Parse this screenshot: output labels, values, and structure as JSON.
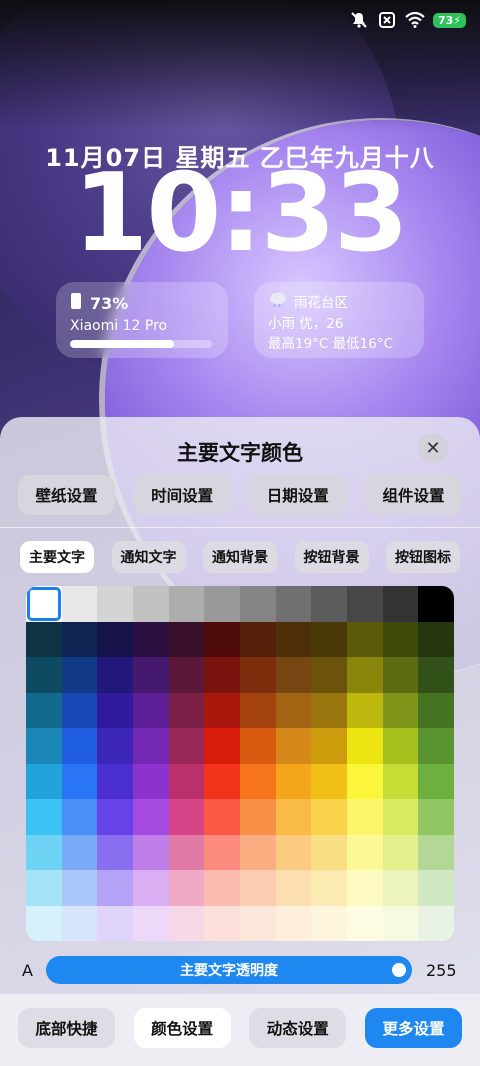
{
  "status_bar": {
    "battery": "73"
  },
  "lockscreen": {
    "date": "11月07日 星期五 乙巳年九月十八",
    "time": "10:33"
  },
  "battery_widget": {
    "percent": "73%",
    "device": "Xiaomi 12 Pro",
    "level": 0.73
  },
  "weather_widget": {
    "location": "雨花台区",
    "condition": "小雨 优，26",
    "range": "最高19°C  最低16°C"
  },
  "panel": {
    "title": "主要文字颜色",
    "top_tabs": [
      "壁纸设置",
      "时间设置",
      "日期设置",
      "组件设置"
    ],
    "sub_tabs": [
      "主要文字",
      "通知文字",
      "通知背景",
      "按钮背景",
      "按钮图标"
    ],
    "slider": {
      "prefix": "A",
      "label": "主要文字透明度",
      "value": "255"
    },
    "bottom_buttons": [
      "底部快捷",
      "颜色设置",
      "动态设置",
      "更多设置"
    ]
  },
  "palette": [
    [
      "#ffffff",
      "#e8e8e8",
      "#d4d4d4",
      "#c2c2c2",
      "#adadad",
      "#999999",
      "#858585",
      "#707070",
      "#5c5c5c",
      "#474747",
      "#333333",
      "#000000"
    ],
    [
      "#0d3344",
      "#0f2554",
      "#16124a",
      "#2c1042",
      "#3a0f2a",
      "#4f0a0a",
      "#54200a",
      "#4d300a",
      "#4a3a08",
      "#5a5a08",
      "#3f4a0a",
      "#25360f"
    ],
    [
      "#0f4a63",
      "#123a86",
      "#22187a",
      "#451a6e",
      "#5c1838",
      "#7a120e",
      "#7c2e0c",
      "#754512",
      "#6c530c",
      "#8a860b",
      "#5d6b12",
      "#325118"
    ],
    [
      "#126a8f",
      "#1847b6",
      "#2f1a9e",
      "#5e1f96",
      "#7c1f47",
      "#a8160c",
      "#a3420f",
      "#a36514",
      "#9b760e",
      "#bdb80d",
      "#7f951a",
      "#467322"
    ],
    [
      "#1a87b7",
      "#1f5ee0",
      "#3b26b8",
      "#7427b4",
      "#9a2857",
      "#d81c0a",
      "#d95b0f",
      "#d5891b",
      "#cc9c0d",
      "#ece512",
      "#a6c01d",
      "#5a9430"
    ],
    [
      "#22a3db",
      "#2a75f5",
      "#4b2ed0",
      "#8b33cc",
      "#b9306a",
      "#f2321a",
      "#f6741a",
      "#f5a71b",
      "#f0bf18",
      "#fbf53c",
      "#c6dd35",
      "#6eb040"
    ],
    [
      "#3dc3f3",
      "#4b8ef7",
      "#6643e6",
      "#a34be0",
      "#d54487",
      "#fa5a45",
      "#f98e46",
      "#f9bb45",
      "#f7d24a",
      "#fcf76a",
      "#d9e960",
      "#92c663"
    ],
    [
      "#6fd3f6",
      "#78aaf8",
      "#8a6ef0",
      "#c07ee9",
      "#e17aa5",
      "#fb8c7d",
      "#faad80",
      "#fbcb7f",
      "#f9de83",
      "#fcf898",
      "#e4ee8d",
      "#b3d896"
    ],
    [
      "#a4e3f8",
      "#a9c7fa",
      "#b5a2f6",
      "#d9aef2",
      "#eeaac6",
      "#fcbab0",
      "#fccbb0",
      "#fcdfb1",
      "#fbebb3",
      "#fdfbc3",
      "#edf4bb",
      "#d1e8c4"
    ],
    [
      "#d6f1fc",
      "#d6e4fd",
      "#dfd5fb",
      "#eed8f9",
      "#f7d8e6",
      "#fde0db",
      "#fde7db",
      "#fdefdb",
      "#fdf5dc",
      "#fefde4",
      "#f6fae0",
      "#e9f3e5"
    ]
  ],
  "colors": {
    "accent": "#1e87f0",
    "selected_border": "#1c7ff2"
  }
}
